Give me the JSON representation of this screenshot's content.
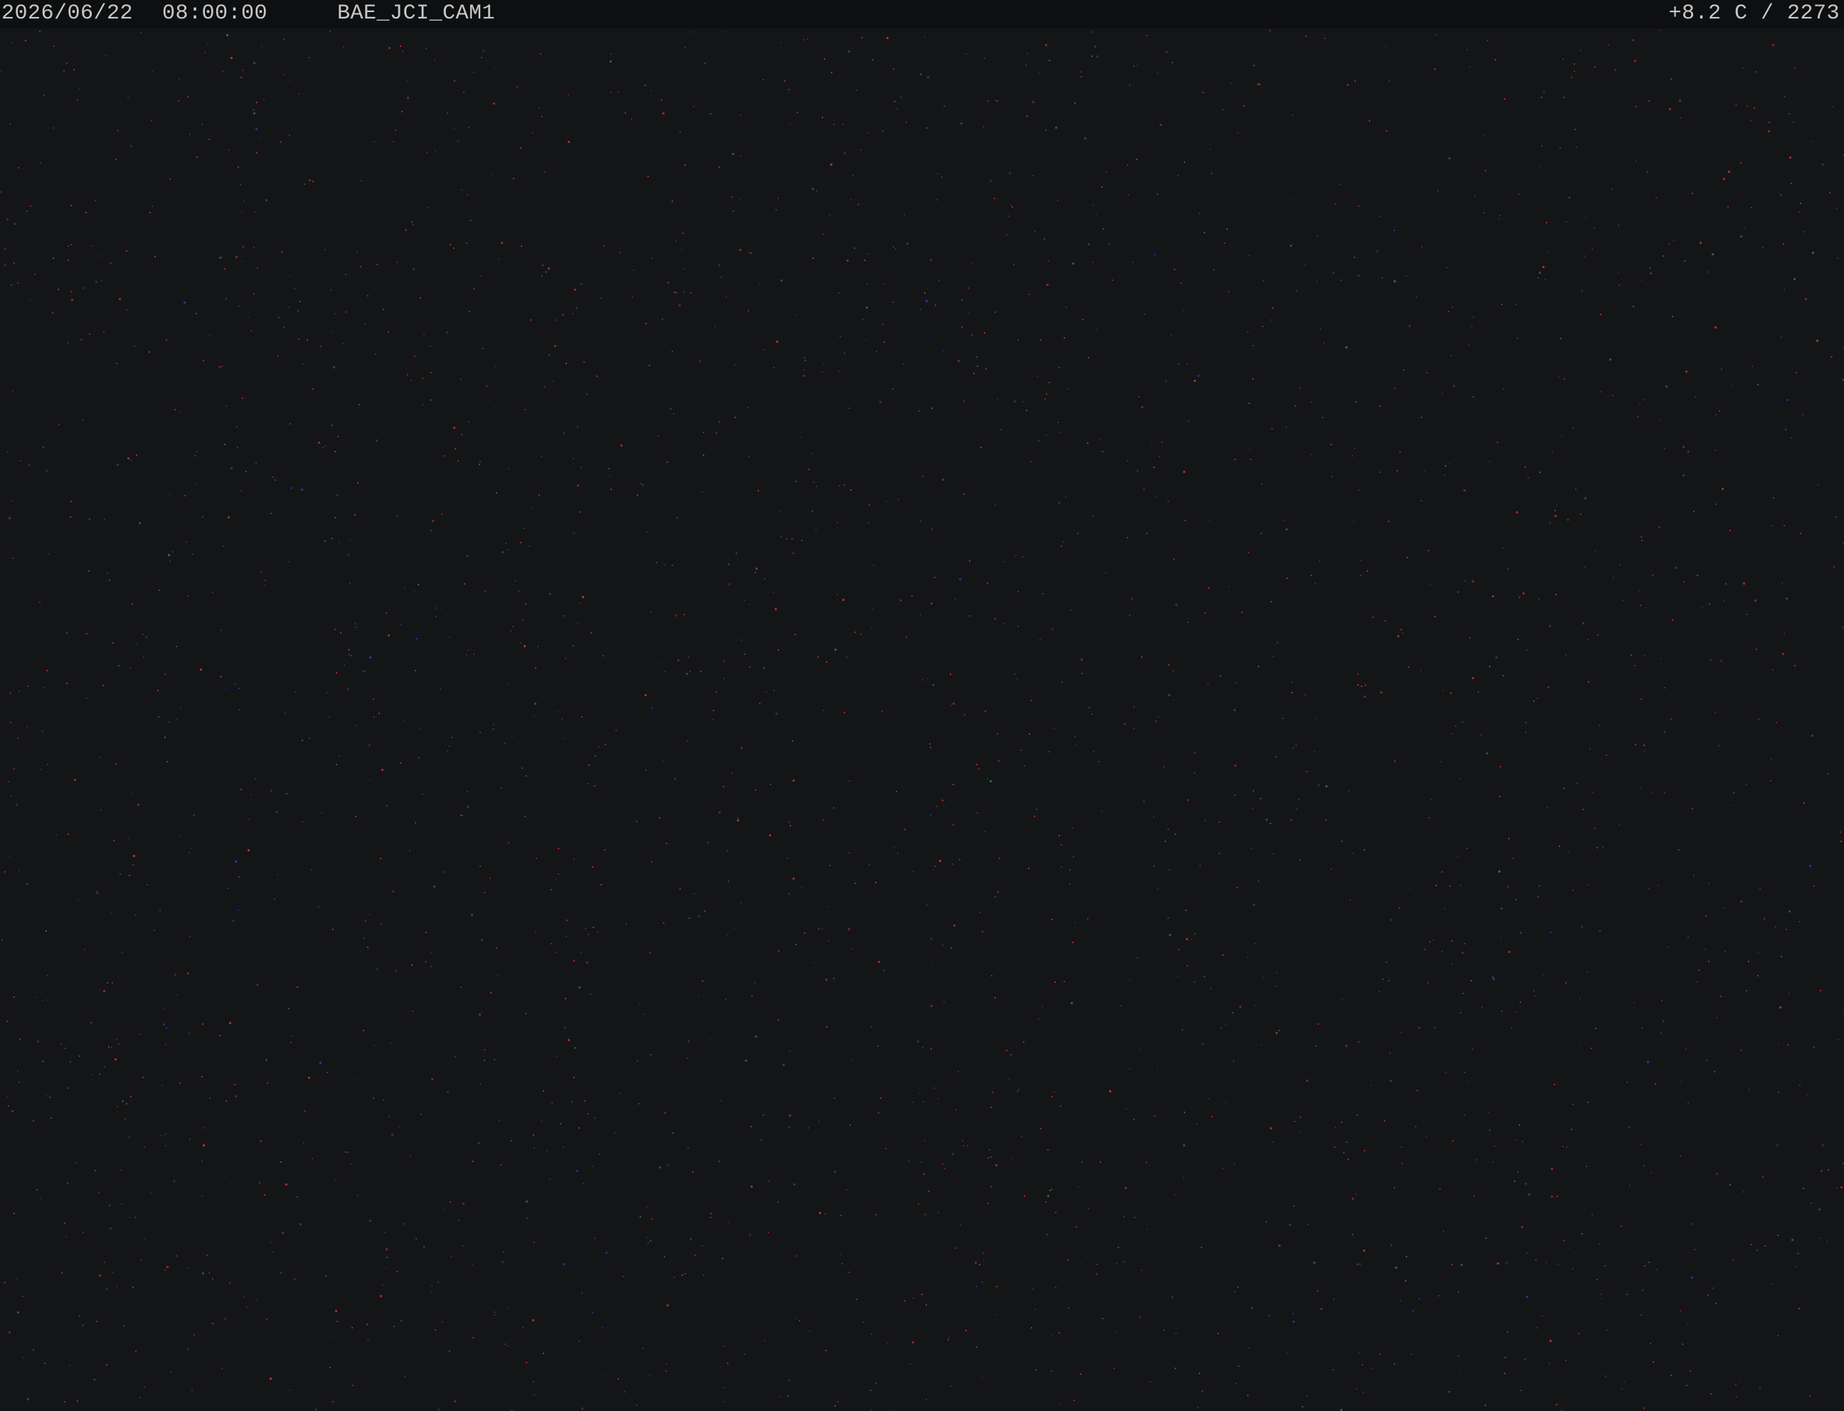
{
  "overlay": {
    "date": "2026/06/22",
    "time": "08:00:00",
    "camera_id": "BAE_JCI_CAM1",
    "sensor_reading": "+8.2 C / 2273"
  },
  "colors": {
    "background": "#141517",
    "overlay_bar": "#0e0f10",
    "overlay_text": "#c8c8c8",
    "noise_red": "#b0303a",
    "noise_green": "#3c6a4a",
    "noise_blue": "#3038a0",
    "noise_gray": "#4a4a50"
  }
}
